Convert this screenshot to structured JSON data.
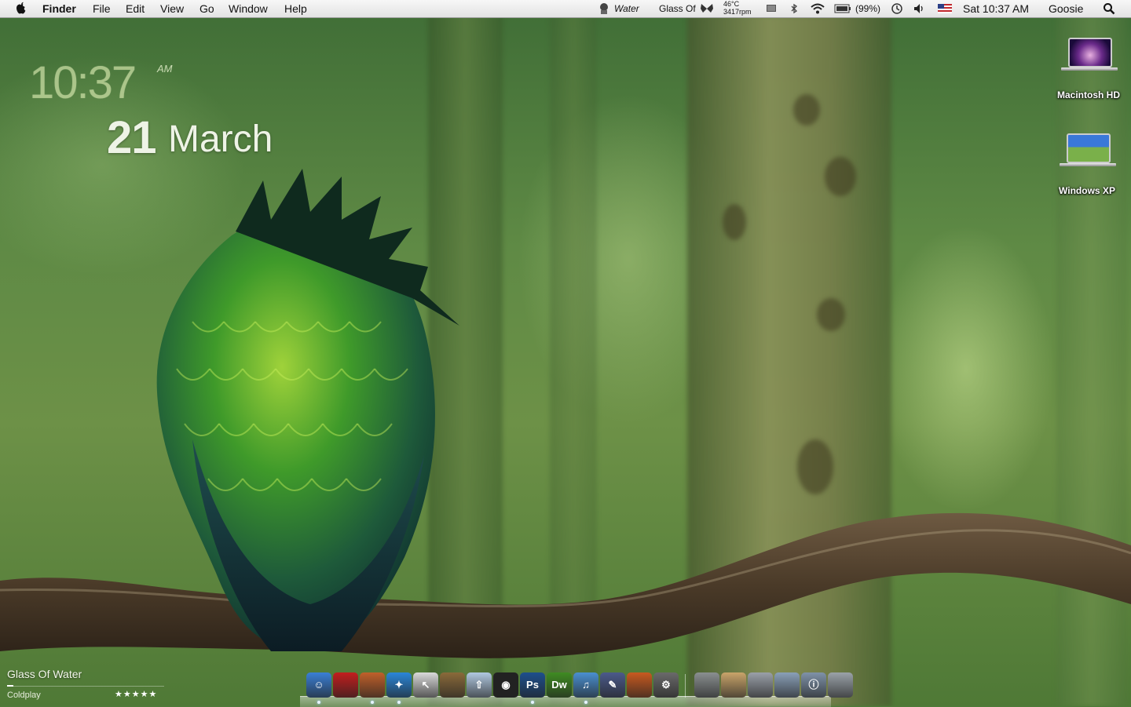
{
  "menubar": {
    "app_name": "Finder",
    "menus": [
      "File",
      "Edit",
      "View",
      "Go",
      "Window",
      "Help"
    ],
    "status": {
      "weather": "Water",
      "now_playing": "Glass Of",
      "temperature": "46°C",
      "fan_speed": "3417rpm",
      "battery": "(99%)",
      "clock": "Sat 10:37 AM",
      "user": "Goosie"
    },
    "icons": [
      "apple-icon",
      "weather-icon",
      "butterfly-icon",
      "display-icon",
      "bluetooth-icon",
      "wifi-icon",
      "battery-icon",
      "time-machine-icon",
      "volume-icon",
      "flag-icon",
      "spotlight-icon"
    ]
  },
  "clock_widget": {
    "time": "10:37",
    "ampm": "AM",
    "day": "21",
    "month": "March"
  },
  "desktop_icons": [
    {
      "label": "Macintosh HD",
      "icon": "hard-drive-icon"
    },
    {
      "label": "Windows XP",
      "icon": "windows-drive-icon"
    }
  ],
  "now_playing_widget": {
    "title": "Glass Of Water",
    "artist": "Coldplay",
    "rating": "★★★★★",
    "progress": 0.04
  },
  "dock": {
    "apps": [
      {
        "name": "finder",
        "glyph": "☺",
        "color": "#3a7fd5",
        "running": true
      },
      {
        "name": "photobooth",
        "glyph": "",
        "color": "#c21e1e",
        "running": false
      },
      {
        "name": "character-app",
        "glyph": "",
        "color": "#c0602a",
        "running": true
      },
      {
        "name": "safari",
        "glyph": "✦",
        "color": "#2a86d8",
        "running": true
      },
      {
        "name": "cursor-app",
        "glyph": "↖",
        "color": "#d9d9d9",
        "running": false
      },
      {
        "name": "iphoto",
        "glyph": "",
        "color": "#8a6a3a",
        "running": false
      },
      {
        "name": "flickr-uploadr",
        "glyph": "⇧",
        "color": "#b0c8e0",
        "running": false
      },
      {
        "name": "camera-app",
        "glyph": "◉",
        "color": "#222222",
        "running": false
      },
      {
        "name": "photoshop",
        "glyph": "Ps",
        "color": "#1e4f8c",
        "running": true
      },
      {
        "name": "dreamweaver",
        "glyph": "Dw",
        "color": "#3f8b22",
        "running": false
      },
      {
        "name": "itunes",
        "glyph": "♫",
        "color": "#4a8fd0",
        "running": true
      },
      {
        "name": "pen-app",
        "glyph": "✎",
        "color": "#4b5a8a",
        "running": false
      },
      {
        "name": "keynote",
        "glyph": "",
        "color": "#c85a20",
        "running": false
      },
      {
        "name": "system-preferences",
        "glyph": "⚙",
        "color": "#6a6a6a",
        "running": false
      }
    ],
    "stacks": [
      {
        "name": "utilities-stack",
        "glyph": "",
        "color": "#8a8f90"
      },
      {
        "name": "documents-stack",
        "glyph": "",
        "color": "#c9a46a"
      },
      {
        "name": "pictures-stack",
        "glyph": "",
        "color": "#9aa0a8"
      },
      {
        "name": "downloads-stack",
        "glyph": "",
        "color": "#8aa0b8"
      },
      {
        "name": "info-stack",
        "glyph": "ⓘ",
        "color": "#7f92a8"
      },
      {
        "name": "trash",
        "glyph": "",
        "color": "#9aa2a8"
      }
    ]
  }
}
